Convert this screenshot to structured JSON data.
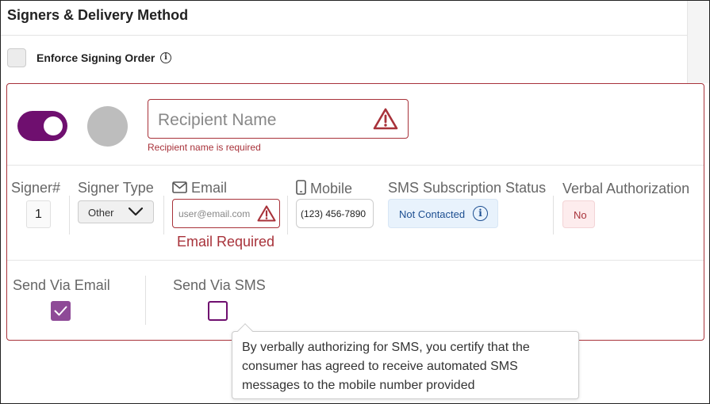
{
  "header": {
    "title": "Signers & Delivery Method"
  },
  "enforce_order": {
    "label": "Enforce Signing Order",
    "info_glyph": "i",
    "checked": false
  },
  "recipient": {
    "enabled": true,
    "name_placeholder": "Recipient Name",
    "name_error": "Recipient name is required"
  },
  "columns": {
    "signer_num": "Signer#",
    "signer_type": "Signer Type",
    "email": "Email",
    "mobile": "Mobile",
    "sms_status": "SMS Subscription Status",
    "verbal_auth": "Verbal Authorization"
  },
  "signer": {
    "number": "1",
    "type": "Other",
    "email_placeholder": "user@email.com",
    "email_error": "Email Required",
    "mobile_value": "(123) 456-7890",
    "sms_status": "Not Contacted",
    "sms_info_glyph": "i",
    "verbal_authorization": "No"
  },
  "send": {
    "email_label": "Send Via Email",
    "email_checked": true,
    "sms_label": "Send Via SMS",
    "sms_checked": false
  },
  "tooltip": {
    "text": "By verbally authorizing for SMS, you certify that the consumer has agreed to receive automated SMS messages to the mobile number provided"
  },
  "colors": {
    "error": "#a8323a",
    "toggle": "#6f0f6f",
    "checkbox": "#8e4a97",
    "status_blue": "#1d4f91"
  },
  "icons": {
    "warning": "warning-triangle-icon",
    "email": "envelope-icon",
    "mobile": "mobile-phone-icon",
    "info": "info-circle-icon",
    "dropdown": "chevron-down-icon",
    "check": "checkmark-icon"
  }
}
